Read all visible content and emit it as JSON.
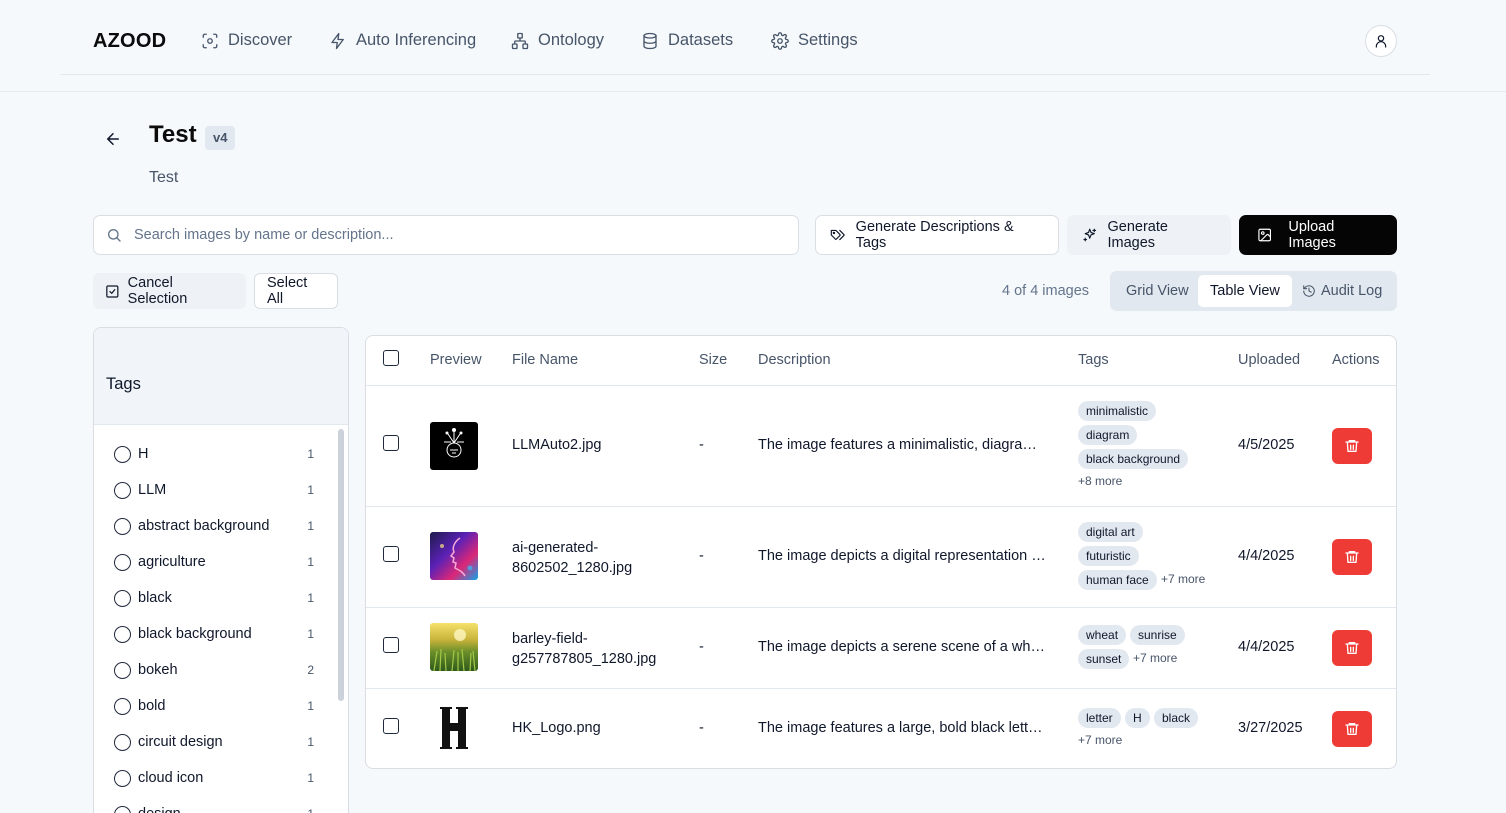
{
  "nav": {
    "brand": "AZOOD",
    "items": [
      {
        "label": "Discover",
        "icon": "scan-icon"
      },
      {
        "label": "Auto Inferencing",
        "icon": "lightning-icon"
      },
      {
        "label": "Ontology",
        "icon": "hierarchy-icon"
      },
      {
        "label": "Datasets",
        "icon": "database-icon"
      },
      {
        "label": "Settings",
        "icon": "gear-icon"
      }
    ],
    "user_icon": "user-icon"
  },
  "header": {
    "title": "Test",
    "version": "v4",
    "subtitle": "Test"
  },
  "toolbar": {
    "search_placeholder": "Search images by name or description...",
    "generate_desc_label": "Generate Descriptions & Tags",
    "generate_images_label": "Generate Images",
    "upload_label": "Upload Images",
    "cancel_selection_label": "Cancel Selection",
    "select_all_label": "Select All",
    "count_text": "4 of 4 images",
    "views": {
      "grid": "Grid View",
      "table": "Table View",
      "audit": "Audit Log",
      "active": "Table View"
    }
  },
  "tags_panel": {
    "title": "Tags",
    "tags": [
      {
        "name": "H",
        "count": "1"
      },
      {
        "name": "LLM",
        "count": "1"
      },
      {
        "name": "abstract background",
        "count": "1"
      },
      {
        "name": "agriculture",
        "count": "1"
      },
      {
        "name": "black",
        "count": "1"
      },
      {
        "name": "black background",
        "count": "1"
      },
      {
        "name": "bokeh",
        "count": "2"
      },
      {
        "name": "bold",
        "count": "1"
      },
      {
        "name": "circuit design",
        "count": "1"
      },
      {
        "name": "cloud icon",
        "count": "1"
      },
      {
        "name": "design",
        "count": "1"
      }
    ]
  },
  "table": {
    "headers": {
      "preview": "Preview",
      "file_name": "File Name",
      "size": "Size",
      "description": "Description",
      "tags": "Tags",
      "uploaded": "Uploaded",
      "actions": "Actions"
    },
    "rows": [
      {
        "file_name": "LLMAuto2.jpg",
        "size": "-",
        "description": "The image features a minimalistic, diagrammatic illustration",
        "tags": [
          "minimalistic",
          "diagram",
          "black background"
        ],
        "more": "+8 more",
        "uploaded": "4/5/2025"
      },
      {
        "file_name": "ai-generated-8602502_1280.jpg",
        "size": "-",
        "description": "The image depicts a digital representation of a human face",
        "tags": [
          "digital art",
          "futuristic",
          "human face"
        ],
        "more": "+7 more",
        "uploaded": "4/4/2025"
      },
      {
        "file_name": "barley-field-g257787805_1280.jpg",
        "size": "-",
        "description": "The image depicts a serene scene of a wheat field at sunrise",
        "tags": [
          "wheat",
          "sunrise",
          "sunset"
        ],
        "more": "+7 more",
        "uploaded": "4/4/2025"
      },
      {
        "file_name": "HK_Logo.png",
        "size": "-",
        "description": "The image features a large, bold black letter H",
        "tags": [
          "letter",
          "H",
          "black"
        ],
        "more": "+7 more",
        "uploaded": "3/27/2025"
      }
    ]
  },
  "colors": {
    "delete": "#ef3b36",
    "primary_button": "#050505"
  }
}
